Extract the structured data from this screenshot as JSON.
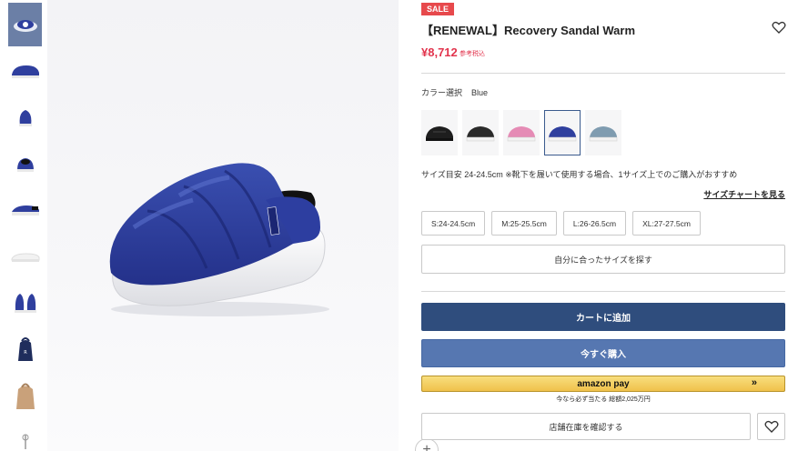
{
  "product": {
    "badge": "SALE",
    "title": "【RENEWAL】Recovery Sandal Warm",
    "price": "¥8,712",
    "tax_note": "参考税込"
  },
  "color": {
    "label": "カラー選択",
    "selected": "Blue",
    "swatches": [
      {
        "name": "black",
        "color": "#1e1e1e"
      },
      {
        "name": "black-white",
        "color": "#2a2a2a"
      },
      {
        "name": "pink",
        "color": "#e58bb5"
      },
      {
        "name": "blue",
        "color": "#2f3f9e"
      },
      {
        "name": "grey-blue",
        "color": "#7f9cb0"
      }
    ]
  },
  "size": {
    "note": "サイズ目安  24-24.5cm ※靴下を履いて使用する場合、1サイズ上でのご購入がおすすめ",
    "chart_link": "サイズチャートを見る",
    "options": [
      "S:24-24.5cm",
      "M:25-25.5cm",
      "L:26-26.5cm",
      "XL:27-27.5cm"
    ],
    "find_button": "自分に合ったサイズを探す"
  },
  "actions": {
    "add_to_cart": "カートに追加",
    "buy_now": "今すぐ購入",
    "amazon_pay": "amazon pay",
    "amazon_chevron": "»",
    "amazon_promo": "今なら必ず当たる 総額2,025万円",
    "store_stock": "店舗在庫を確認する"
  },
  "gallery": {
    "zoom": "+",
    "thumbnail_count": 10,
    "accent": "#2f3f9e"
  }
}
